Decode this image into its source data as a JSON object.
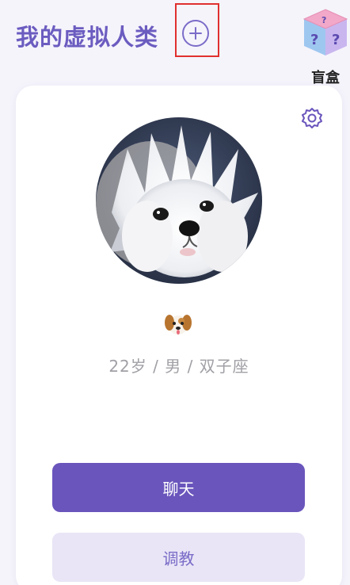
{
  "header": {
    "title": "我的虚拟人类",
    "add_icon": "plus-circle-icon",
    "blind_box": {
      "label": "盲盒",
      "icon": "blind-box-cube-icon"
    }
  },
  "profile": {
    "settings_icon": "gear-icon",
    "avatar": "white-fluffy-dog-photo",
    "pet_emoji_icon": "dog-face-emoji-icon",
    "info": "22岁 / 男 / 双子座"
  },
  "actions": {
    "chat_label": "聊天",
    "train_label": "调教"
  },
  "colors": {
    "accent": "#6a55bc",
    "accent_light": "#e9e5f6",
    "title": "#6b5cc0",
    "highlight_box": "#e0302e",
    "muted_text": "#a0a0a6"
  }
}
